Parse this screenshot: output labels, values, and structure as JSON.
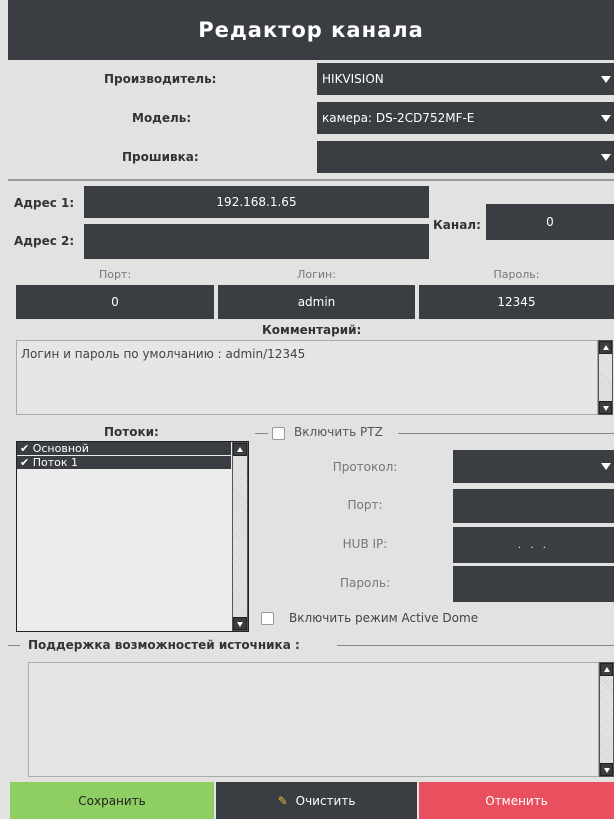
{
  "title": "Редактор канала",
  "vendor": {
    "label": "Производитель:",
    "value": "HIKVISION"
  },
  "model": {
    "label": "Модель:",
    "value": "камера: DS-2CD752MF-E"
  },
  "firmware": {
    "label": "Прошивка:",
    "value": ""
  },
  "address1": {
    "label": "Адрес 1:",
    "value": "192.168.1.65"
  },
  "address2": {
    "label": "Адрес 2:",
    "value": ""
  },
  "channel": {
    "label": "Канал:",
    "value": "0"
  },
  "port": {
    "label": "Порт:",
    "value": "0"
  },
  "login": {
    "label": "Логин:",
    "value": "admin"
  },
  "password": {
    "label": "Пароль:",
    "value": "12345"
  },
  "comment": {
    "label": "Комментарий:",
    "value": "Логин и пароль по умолчанию : admin/12345"
  },
  "streams": {
    "label": "Потоки:",
    "items": [
      {
        "label": "Основной",
        "checked": true
      },
      {
        "label": "Поток 1",
        "checked": true
      }
    ]
  },
  "ptz": {
    "label": "Включить PTZ",
    "protocol_label": "Протокол:",
    "protocol_value": "",
    "port_label": "Порт:",
    "port_value": "",
    "hub_ip_label": "HUB IP:",
    "hub_ip_value": ". . .",
    "password_label": "Пароль:",
    "password_value": "",
    "active_dome_label": "Включить режим Active Dome"
  },
  "capabilities": {
    "label": "Поддержка возможностей источника :",
    "value": ""
  },
  "buttons": {
    "save": "Сохранить",
    "clear": "Очистить",
    "cancel": "Отменить"
  },
  "colors": {
    "dark": "#3a3d42",
    "save": "#8fce63",
    "cancel": "#e8505f",
    "background": "#e2e2e2"
  }
}
